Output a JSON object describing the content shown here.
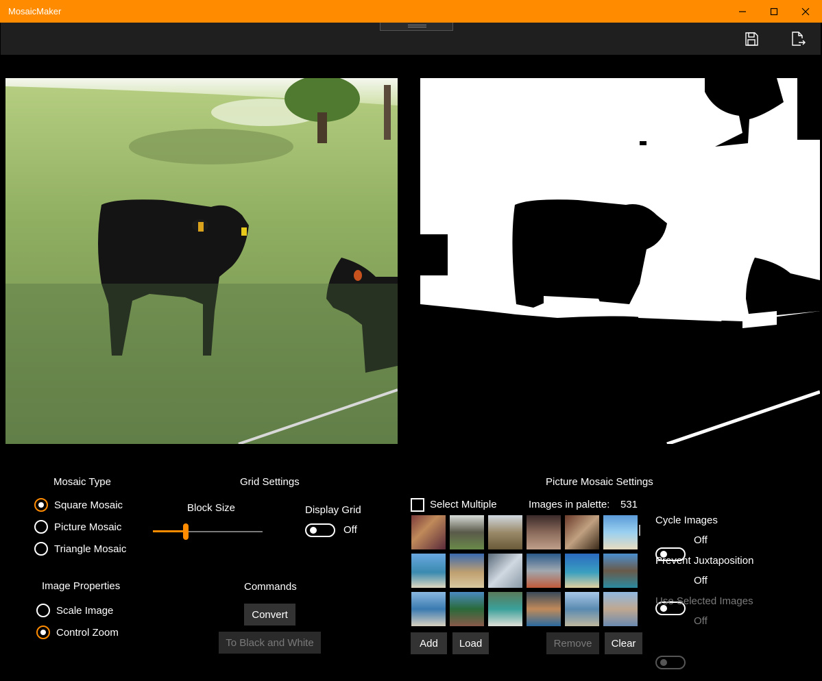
{
  "window": {
    "title": "MosaicMaker"
  },
  "mosaic_type": {
    "heading": "Mosaic Type",
    "options": [
      {
        "label": "Square Mosaic",
        "selected": true
      },
      {
        "label": "Picture Mosaic",
        "selected": false
      },
      {
        "label": "Triangle Mosaic",
        "selected": false
      }
    ]
  },
  "image_properties": {
    "heading": "Image Properties",
    "options": [
      {
        "label": "Scale Image",
        "selected": false
      },
      {
        "label": "Control Zoom",
        "selected": true
      }
    ]
  },
  "grid_settings": {
    "heading": "Grid Settings",
    "block_size_label": "Block Size",
    "block_size_fraction": 0.3,
    "display_grid_label": "Display Grid",
    "display_grid_state": "Off"
  },
  "commands": {
    "heading": "Commands",
    "convert_label": "Convert",
    "bw_label": "To Black and White"
  },
  "picture_mosaic": {
    "heading": "Picture Mosaic Settings",
    "select_multiple_label": "Select Multiple",
    "palette_label": "Images in palette:",
    "palette_count": "531",
    "add_label": "Add",
    "load_label": "Load",
    "remove_label": "Remove",
    "clear_label": "Clear",
    "cycle_images_label": "Cycle Images",
    "cycle_images_state": "Off",
    "prevent_juxtaposition_label": "Prevent Juxtaposition",
    "prevent_juxtaposition_state": "Off",
    "use_selected_label": "Use Selected Images",
    "use_selected_state": "Off"
  },
  "colors": {
    "accent": "#ff8c00",
    "button": "#333333"
  },
  "icons": [
    "minimize-icon",
    "maximize-icon",
    "close-icon",
    "save-icon",
    "export-icon"
  ]
}
